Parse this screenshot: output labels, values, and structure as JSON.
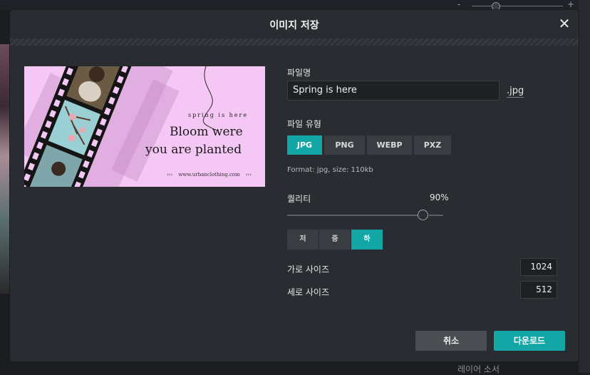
{
  "background": {
    "zoom_minus": "-",
    "zoom_plus": "+",
    "layer_label": "레이어 소서"
  },
  "dialog": {
    "title": "이미지 저장",
    "close_icon": "close-icon"
  },
  "preview": {
    "small_text": "spring is here",
    "headline_1": "Bloom were",
    "headline_2": "you are planted",
    "url": "www.urbanclothing.com"
  },
  "form": {
    "filename_label": "파일명",
    "filename_value": "Spring is here",
    "extension": ".jpg",
    "filetype_label": "파일 유형",
    "formats": [
      "JPG",
      "PNG",
      "WEBP",
      "PXZ"
    ],
    "selected_format": "JPG",
    "format_info": "Format: jpg, size: 110kb",
    "quality_label": "퀄리티",
    "quality_value": "90%",
    "quality_fraction": 0.9,
    "quality_levels": [
      "저",
      "중",
      "하"
    ],
    "selected_quality": "하",
    "width_label": "가로 사이즈",
    "width_value": "1024",
    "height_label": "세로 사이즈",
    "height_value": "512"
  },
  "actions": {
    "cancel": "취소",
    "download": "다운로드"
  },
  "colors": {
    "accent": "#13a6a6",
    "dialog_bg": "#292d31",
    "preview_bg": "#f5c7f4"
  }
}
